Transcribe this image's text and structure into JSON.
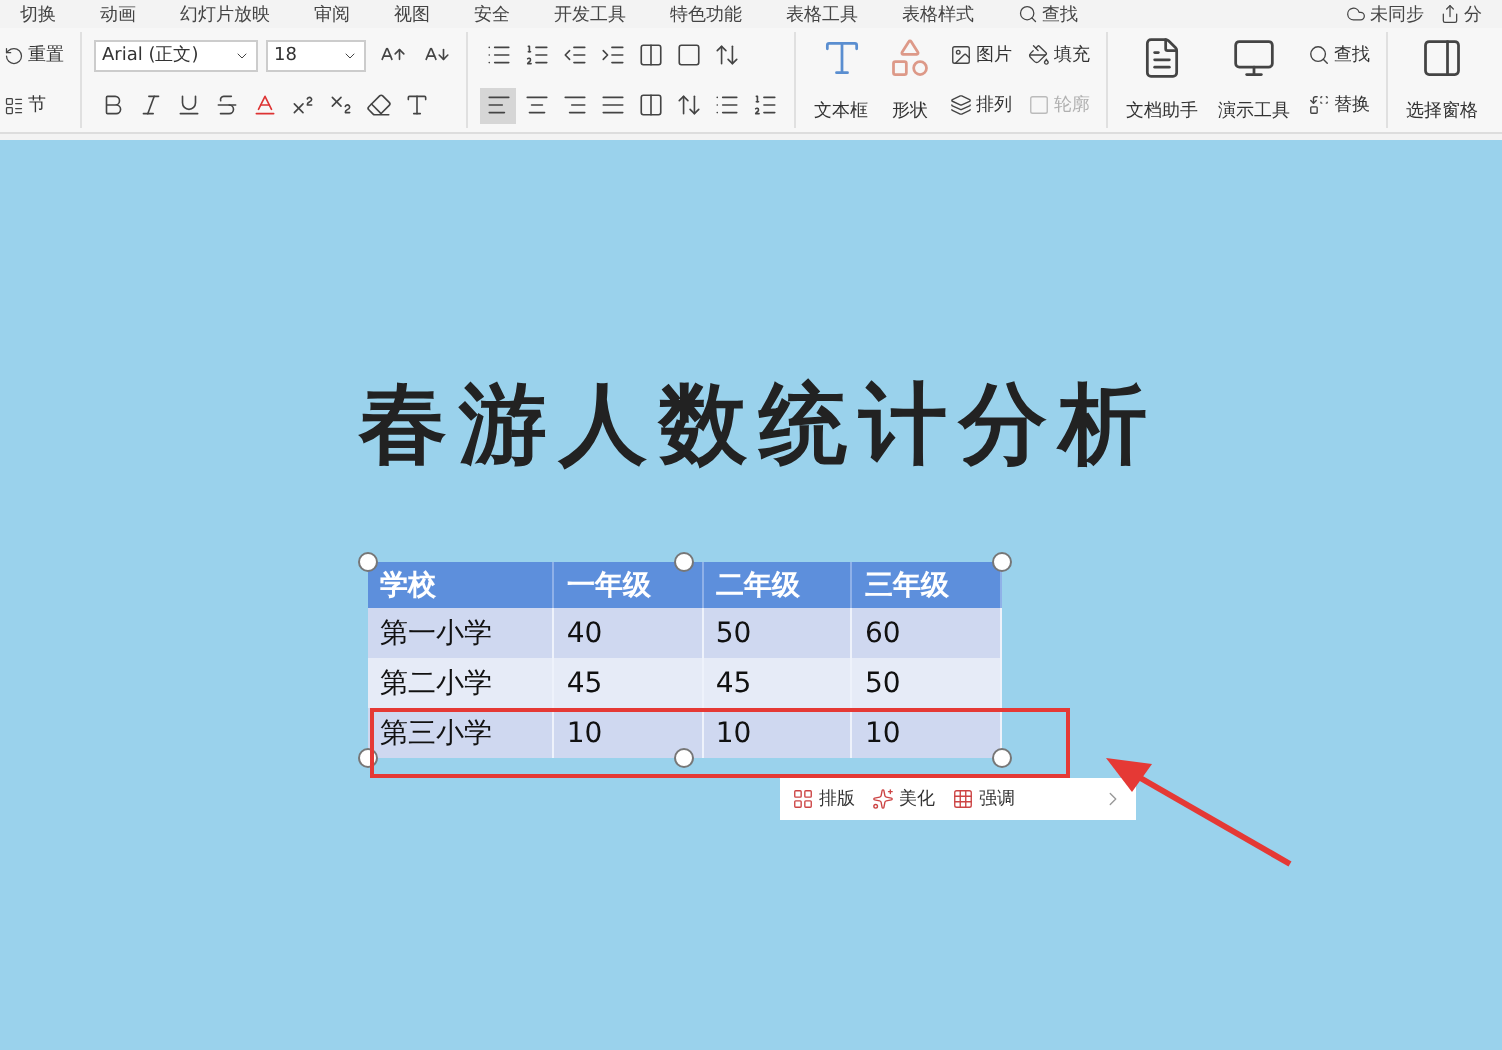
{
  "tabs": [
    {
      "label": "切换",
      "selected": false
    },
    {
      "label": "动画",
      "selected": false
    },
    {
      "label": "幻灯片放映",
      "selected": false
    },
    {
      "label": "审阅",
      "selected": false
    },
    {
      "label": "视图",
      "selected": false
    },
    {
      "label": "安全",
      "selected": false
    },
    {
      "label": "开发工具",
      "selected": false
    },
    {
      "label": "特色功能",
      "selected": false
    },
    {
      "label": "表格工具",
      "selected": false
    },
    {
      "label": "表格样式",
      "selected": false
    }
  ],
  "search_tab": {
    "label": "查找"
  },
  "sync": {
    "label": "未同步"
  },
  "share": {
    "label": "分"
  },
  "slide_group": [
    {
      "label": "重置"
    },
    {
      "label": "节"
    }
  ],
  "font": {
    "name": "Arial (正文)",
    "size": "18"
  },
  "insert_small": [
    {
      "label": "图片",
      "disabled": false
    },
    {
      "label": "排列",
      "disabled": false
    },
    {
      "label": "填充",
      "disabled": false
    },
    {
      "label": "轮廓",
      "disabled": true
    }
  ],
  "insert_large": [
    {
      "label": "文本框"
    },
    {
      "label": "形状"
    }
  ],
  "tools_large": [
    {
      "label": "文档助手"
    },
    {
      "label": "演示工具"
    }
  ],
  "edit_small": [
    {
      "label": "查找"
    },
    {
      "label": "替换"
    }
  ],
  "select_pane": {
    "label": "选择窗格"
  },
  "slide": {
    "title": "春游人数统计分析",
    "table": {
      "columns": [
        "学校",
        "一年级",
        "二年级",
        "三年级"
      ],
      "rows": [
        [
          "第一小学",
          "40",
          "50",
          "60"
        ],
        [
          "第二小学",
          "45",
          "45",
          "50"
        ],
        [
          "第三小学",
          "10",
          "10",
          "10"
        ]
      ]
    },
    "quick_bar": [
      {
        "label": "排版"
      },
      {
        "label": "美化"
      },
      {
        "label": "强调"
      }
    ]
  }
}
